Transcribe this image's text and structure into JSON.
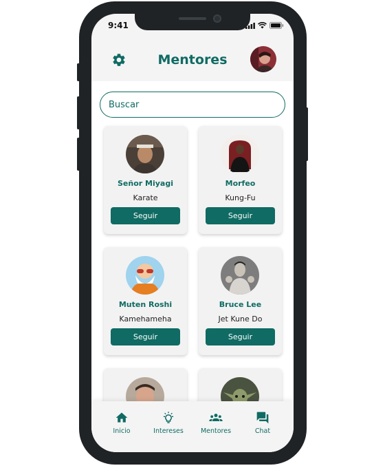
{
  "status": {
    "time": "9:41"
  },
  "header": {
    "title": "Mentores"
  },
  "search": {
    "placeholder": "Buscar"
  },
  "mentors": [
    {
      "name": "Señor Miyagi",
      "skill": "Karate",
      "button": "Seguir"
    },
    {
      "name": "Morfeo",
      "skill": "Kung-Fu",
      "button": "Seguir"
    },
    {
      "name": "Muten Roshi",
      "skill": "Kamehameha",
      "button": "Seguir"
    },
    {
      "name": "Bruce Lee",
      "skill": "Jet Kune Do",
      "button": "Seguir"
    }
  ],
  "nav": [
    {
      "label": "Inicio",
      "icon": "home-icon"
    },
    {
      "label": "Intereses",
      "icon": "lightbulb-icon"
    },
    {
      "label": "Mentores",
      "icon": "group-icon"
    },
    {
      "label": "Chat",
      "icon": "chat-icon"
    }
  ],
  "colors": {
    "primary": "#0f6b63",
    "background": "#f4f4f4"
  }
}
